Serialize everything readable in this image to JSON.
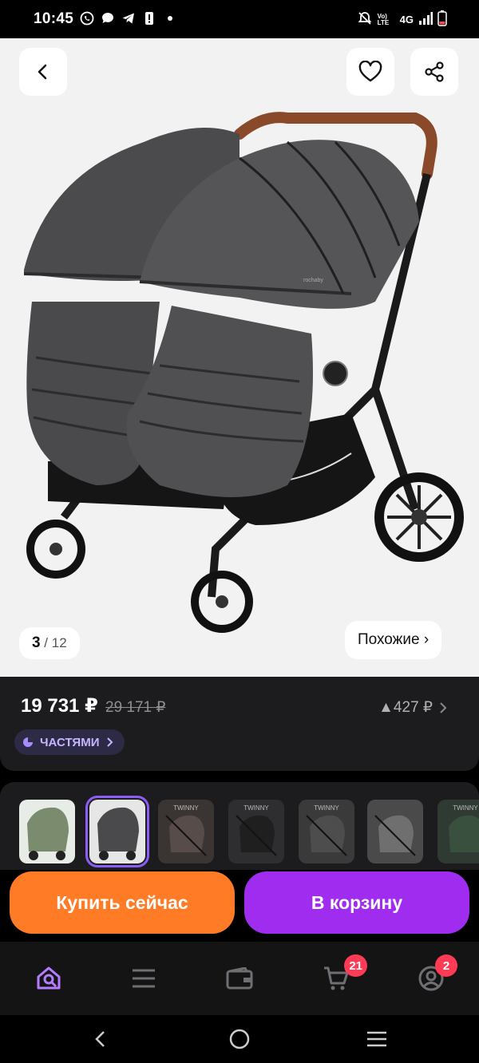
{
  "status_bar": {
    "time": "10:45",
    "network": "4G",
    "volte": "Vo) LTE"
  },
  "product": {
    "image_counter_current": "3",
    "image_counter_sep": " / ",
    "image_counter_total": "12",
    "similar_label": "Похожие ›",
    "price": "19 731 ₽",
    "old_price": "29 171 ₽",
    "points": "▲427 ₽",
    "parts_label": "ЧАСТЯМИ",
    "brand_on_canopy": "rochaby",
    "thumb_label": "TWINNY"
  },
  "actions": {
    "buy_now": "Купить сейчас",
    "add_to_cart": "В корзину"
  },
  "bottom_nav": {
    "cart_badge": "21",
    "profile_badge": "2"
  },
  "colors": {
    "accent_purple": "#a02cf0",
    "accent_orange": "#ff7b26",
    "badge_red": "#ff3a55"
  }
}
